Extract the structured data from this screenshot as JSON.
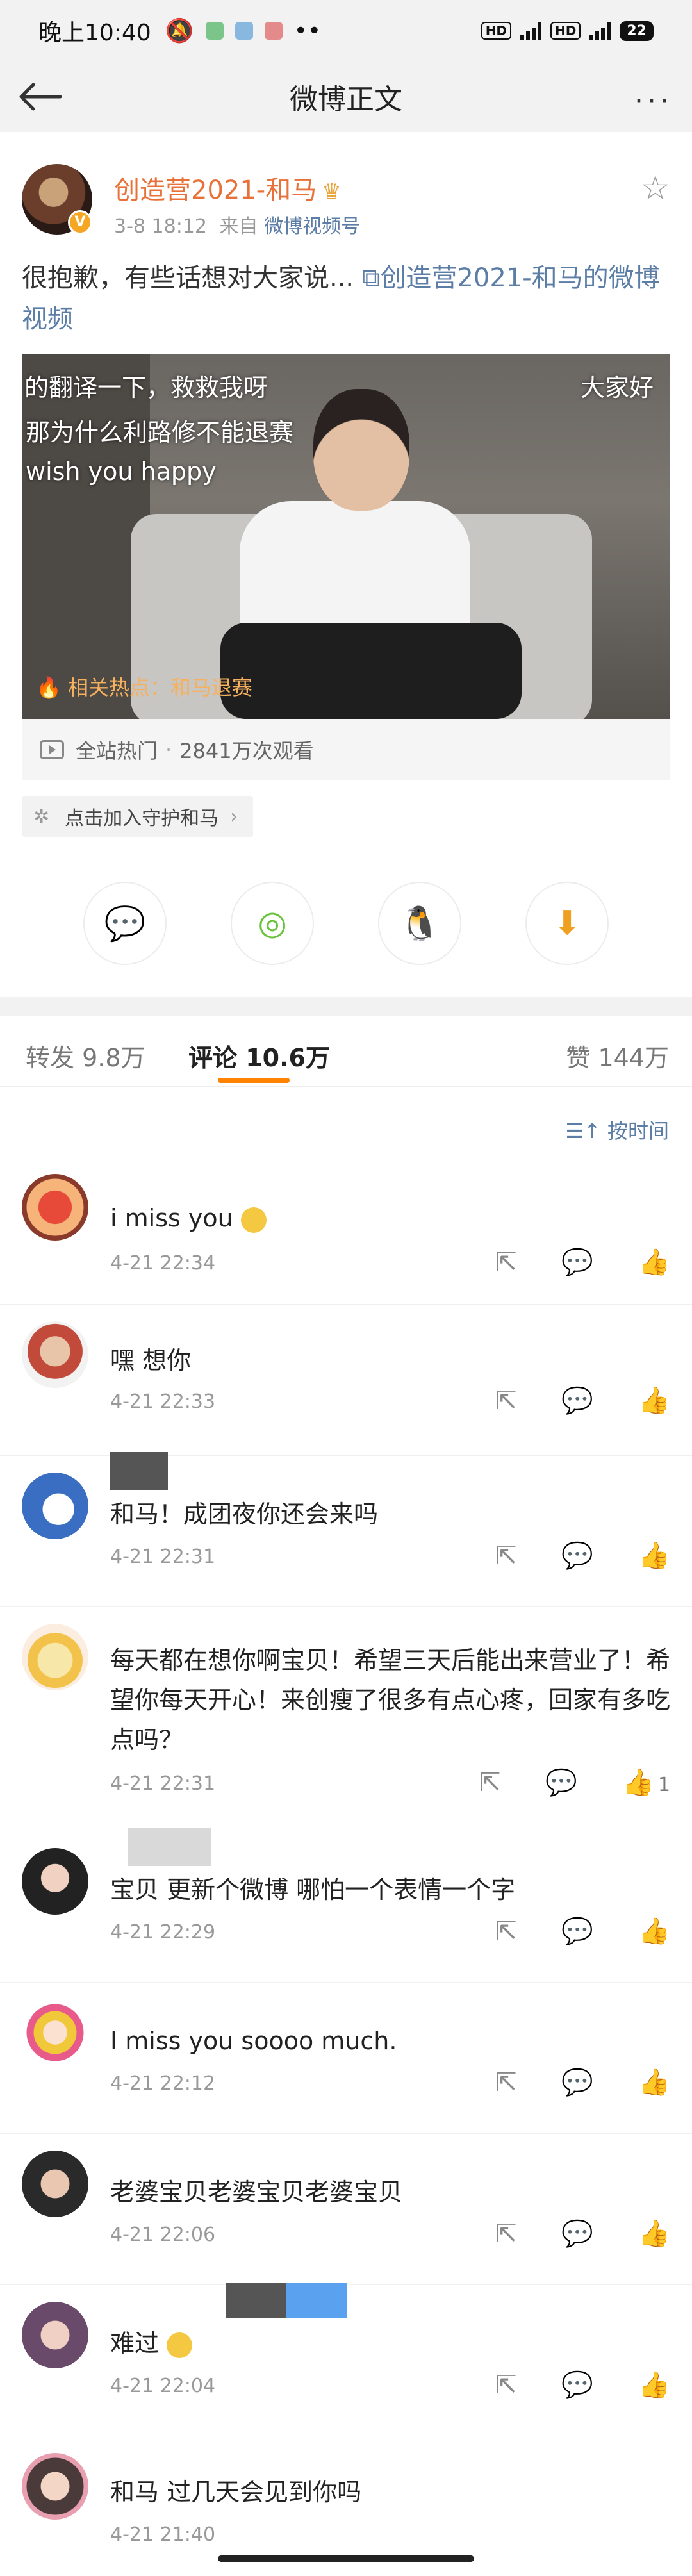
{
  "status_bar": {
    "time": "晚上10:40",
    "hd1": "HD",
    "hd2": "HD",
    "net": "4G",
    "battery": "22"
  },
  "nav": {
    "title": "微博正文",
    "more": "···"
  },
  "post": {
    "author_name": "创造营2021-和马",
    "date": "3-8 18:12",
    "source_prefix": "来自",
    "source": "微博视频号",
    "text": "很抱歉，有些话想对大家说...",
    "link_text": "创造营2021-和马的微博视频",
    "video": {
      "caption_line1": "的翻译一下，救救我呀",
      "caption_line2": "那为什么利路修不能退赛",
      "caption_line3": "wish you happy",
      "caption_right": "大家好",
      "hot_label": "相关热点：和马退赛"
    },
    "stats": {
      "label": "全站热门",
      "views": "2841万次观看"
    },
    "guard_label": "点击加入守护和马"
  },
  "tabs": {
    "repost": "转发 9.8万",
    "comments": "评论 10.6万",
    "likes": "赞 144万"
  },
  "sort_label": "按时间",
  "comments": [
    {
      "text": "i miss you",
      "time": "4-21 22:34",
      "likes": ""
    },
    {
      "text": "嘿 想你",
      "time": "4-21 22:33",
      "likes": ""
    },
    {
      "text": "和马！成团夜你还会来吗",
      "time": "4-21 22:31",
      "likes": ""
    },
    {
      "text": "每天都在想你啊宝贝！希望三天后能出来营业了！希望你每天开心！来创瘦了很多有点心疼，回家有多吃点吗？",
      "time": "4-21 22:31",
      "likes": "1"
    },
    {
      "text": "宝贝 更新个微博 哪怕一个表情一个字",
      "time": "4-21 22:29",
      "likes": ""
    },
    {
      "text": "I miss you soooo much.",
      "time": "4-21 22:12",
      "likes": ""
    },
    {
      "text": "老婆宝贝老婆宝贝老婆宝贝",
      "time": "4-21 22:06",
      "likes": ""
    },
    {
      "text": "难过",
      "time": "4-21 22:04",
      "likes": ""
    },
    {
      "text": "和马 过几天会见到你吗",
      "time": "4-21 21:40",
      "likes": ""
    }
  ]
}
